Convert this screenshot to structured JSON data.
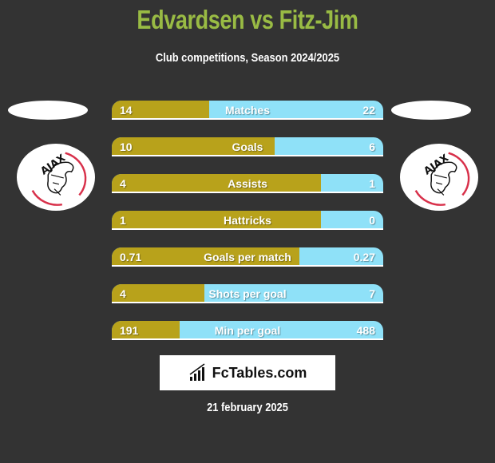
{
  "header": {
    "title": "Edvardsen vs Fitz-Jim",
    "subtitle": "Club competitions, Season 2024/2025"
  },
  "colors": {
    "title": "#99bb44",
    "left_bar": "#b8a21b",
    "right_bar": "#8fe1f8",
    "background": "#333333"
  },
  "left_team": {
    "logo_icon": "ajax-logo-icon",
    "logo_text": "AJAX"
  },
  "right_team": {
    "logo_icon": "ajax-logo-icon",
    "logo_text": "AJAX"
  },
  "stats": [
    {
      "label": "Matches",
      "left": "14",
      "right": "22",
      "left_share": 0.36
    },
    {
      "label": "Goals",
      "left": "10",
      "right": "6",
      "left_share": 0.6
    },
    {
      "label": "Assists",
      "left": "4",
      "right": "1",
      "left_share": 0.77
    },
    {
      "label": "Hattricks",
      "left": "1",
      "right": "0",
      "left_share": 0.77
    },
    {
      "label": "Goals per match",
      "left": "0.71",
      "right": "0.27",
      "left_share": 0.69
    },
    {
      "label": "Shots per goal",
      "left": "4",
      "right": "7",
      "left_share": 0.34
    },
    {
      "label": "Min per goal",
      "left": "191",
      "right": "488",
      "left_share": 0.25
    }
  ],
  "brand": {
    "icon": "bar-chart-icon",
    "text": "FcTables.com"
  },
  "date": "21 february 2025"
}
